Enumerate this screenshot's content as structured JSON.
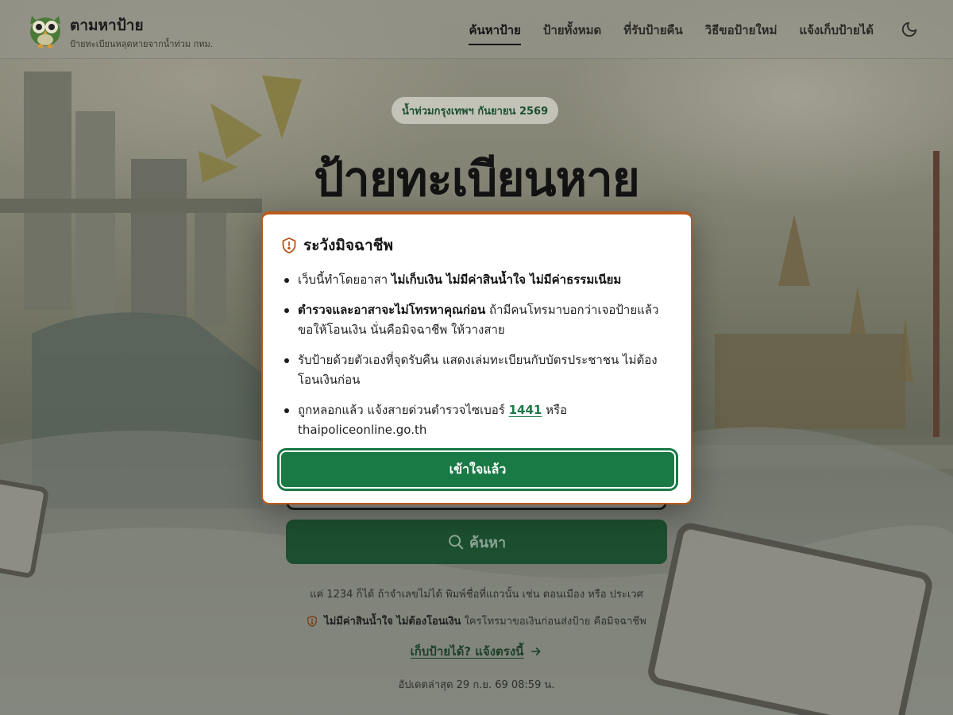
{
  "header": {
    "brand_title": "ตามหาป้าย",
    "brand_subtitle": "ป้ายทะเบียนหลุดหายจากน้ำท่วม กทม.",
    "nav": [
      {
        "label": "ค้นหาป้าย",
        "active": true
      },
      {
        "label": "ป้ายทั้งหมด",
        "active": false
      },
      {
        "label": "ที่รับป้ายคืน",
        "active": false
      },
      {
        "label": "วิธีขอป้ายใหม่",
        "active": false
      },
      {
        "label": "แจ้งเก็บป้ายได้",
        "active": false
      }
    ],
    "theme_icon": "moon-icon"
  },
  "hero": {
    "badge": "น้ำท่วมกรุงเทพฯ กันยายน 2569",
    "title": "ป้ายทะเบียนหาย",
    "search_button_label": "ค้นหา",
    "hint": "แค่ 1234 ก็ได้ ถ้าจำเลขไม่ได้ พิมพ์ชื่อที่แถวนั้น เช่น ดอนเมือง หรือ ประเวศ",
    "warning_bold": "ไม่มีค่าสินน้ำใจ ไม่ต้องโอนเงิน",
    "warning_rest": "ใครโทรมาขอเงินก่อนส่งป้าย คือมิจฉาชีพ",
    "report_link": "เก็บป้ายได้? แจ้งตรงนี้",
    "updated": "อัปเดตล่าสุด 29 ก.ย. 69 08:59 น."
  },
  "modal": {
    "title": "ระวังมิจฉาชีพ",
    "item1_pre": "เว็บนี้ทำโดยอาสา ",
    "item1_bold": "ไม่เก็บเงิน ไม่มีค่าสินน้ำใจ ไม่มีค่าธรรมเนียม",
    "item2_bold": "ตำรวจและอาสาจะไม่โทรหาคุณก่อน",
    "item2_rest": " ถ้ามีคนโทรมาบอกว่าเจอป้ายแล้วขอให้โอนเงิน นั่นคือมิจฉาชีพ ให้วางสาย",
    "item3": "รับป้ายด้วยตัวเองที่จุดรับคืน แสดงเล่มทะเบียนกับบัตรประชาชน ไม่ต้องโอนเงินก่อน",
    "item4_pre": "ถูกหลอกแล้ว แจ้งสายด่วนตำรวจไซเบอร์ ",
    "item4_hotline": "1441",
    "item4_mid": " หรือ",
    "item4_site": "thaipoliceonline.go.th",
    "confirm_label": "เข้าใจแล้ว"
  },
  "colors": {
    "primary_green": "#1a7a46",
    "dark_green": "#1c4f30",
    "modal_border": "#b85a1c"
  }
}
